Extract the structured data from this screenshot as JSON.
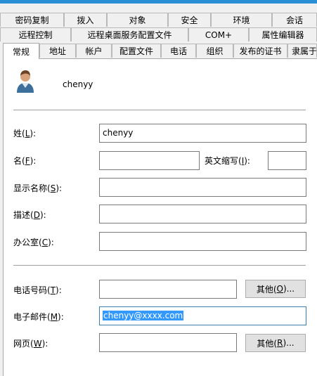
{
  "tabs_row1": [
    {
      "label": "密码复制"
    },
    {
      "label": "拨入"
    },
    {
      "label": "对象"
    },
    {
      "label": "安全"
    },
    {
      "label": "环境"
    },
    {
      "label": "会话"
    }
  ],
  "tabs_row2": [
    {
      "label": "远程控制"
    },
    {
      "label": "远程桌面服务配置文件"
    },
    {
      "label": "COM+"
    },
    {
      "label": "属性编辑器"
    }
  ],
  "tabs_row3": [
    {
      "label": "常规"
    },
    {
      "label": "地址"
    },
    {
      "label": "帐户"
    },
    {
      "label": "配置文件"
    },
    {
      "label": "电话"
    },
    {
      "label": "组织"
    },
    {
      "label": "发布的证书"
    },
    {
      "label": "隶属于"
    }
  ],
  "active_tab": "常规",
  "user": {
    "display": "chenyy"
  },
  "form": {
    "last_name": {
      "label": "姓(",
      "key": "L",
      "suffix": "):",
      "value": "chenyy"
    },
    "first_name": {
      "label": "名(",
      "key": "F",
      "suffix": "):",
      "value": ""
    },
    "initials": {
      "label": "英文缩写(",
      "key": "I",
      "suffix": "):",
      "value": ""
    },
    "display_name": {
      "label": "显示名称(",
      "key": "S",
      "suffix": "):",
      "value": ""
    },
    "description": {
      "label": "描述(",
      "key": "D",
      "suffix": "):",
      "value": ""
    },
    "office": {
      "label": "办公室(",
      "key": "C",
      "suffix": "):",
      "value": ""
    },
    "phone": {
      "label": "电话号码(",
      "key": "T",
      "suffix": "):",
      "value": ""
    },
    "email": {
      "label": "电子邮件(",
      "key": "M",
      "suffix": "):",
      "value": "chenyy@xxxx.com"
    },
    "webpage": {
      "label": "网页(",
      "key": "W",
      "suffix": "):",
      "value": ""
    }
  },
  "buttons": {
    "phone_other": {
      "label": "其他(",
      "key": "O",
      "suffix": ")..."
    },
    "web_other": {
      "label": "其他(",
      "key": "R",
      "suffix": ")..."
    }
  },
  "colors": {
    "selection": "#3399ff",
    "panel": "#ffffff",
    "dialog": "#f0f0f0",
    "title_strip": "#2a8fd6"
  }
}
